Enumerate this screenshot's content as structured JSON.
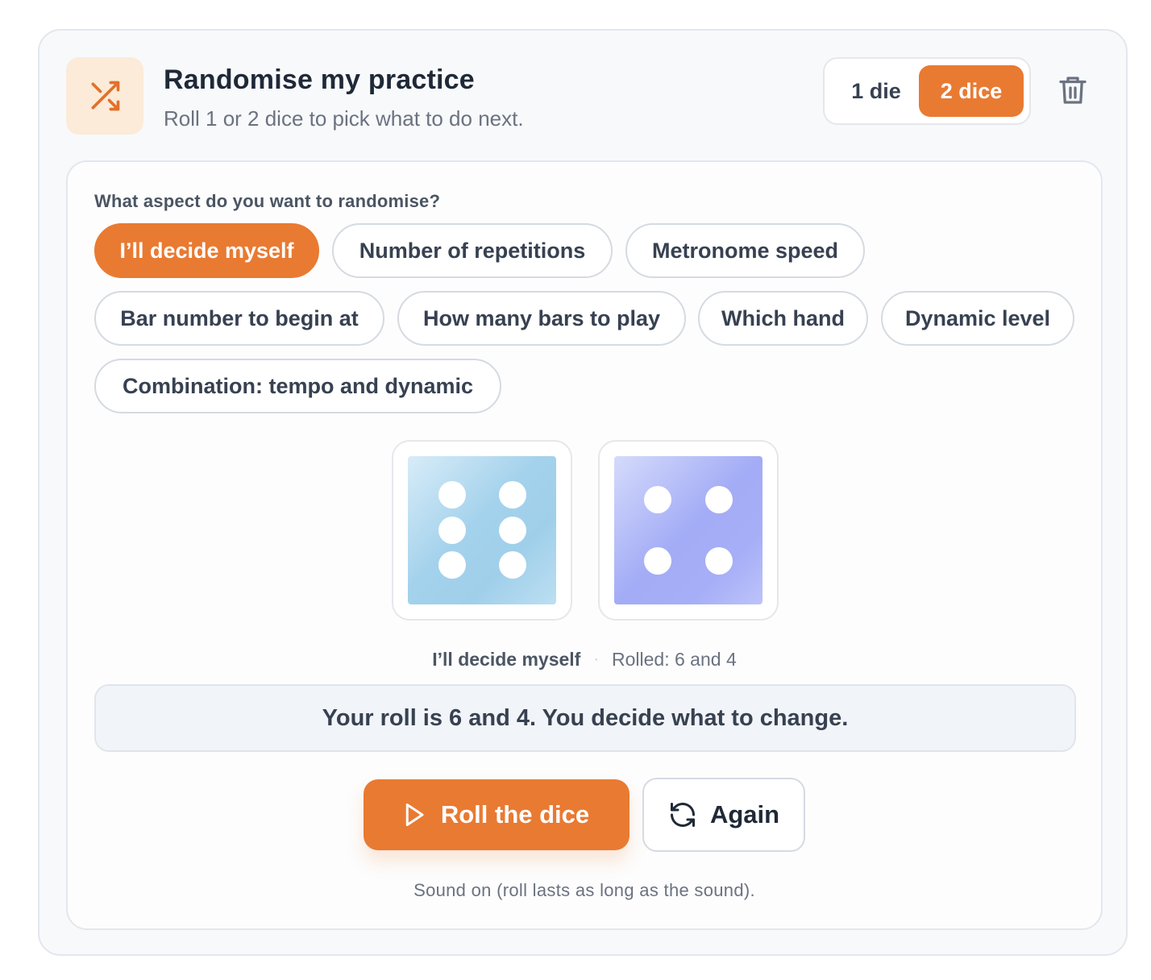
{
  "header": {
    "title": "Randomise my practice",
    "subtitle": "Roll 1 or 2 dice to pick what to do next.",
    "icon": "shuffle-icon",
    "accent_color": "#e97a32"
  },
  "dice_count_toggle": {
    "options": [
      "1 die",
      "2 dice"
    ],
    "selected": "2 dice"
  },
  "delete_icon": "trash-icon",
  "aspect_selector": {
    "question": "What aspect do you want to randomise?",
    "options": [
      "I’ll decide myself",
      "Number of repetitions",
      "Metronome speed",
      "Bar number to begin at",
      "How many bars to play",
      "Which hand",
      "Dynamic level",
      "Combination: tempo and dynamic"
    ],
    "selected": "I’ll decide myself"
  },
  "dice": {
    "values": [
      6,
      4
    ]
  },
  "result": {
    "aspect": "I’ll decide myself",
    "separator": "·",
    "rolled_text": "Rolled: 6 and 4",
    "message": "Your roll is 6 and 4. You decide what to change."
  },
  "actions": {
    "roll_label": "Roll the dice",
    "roll_icon": "play-icon",
    "again_label": "Again",
    "again_icon": "refresh-icon"
  },
  "sound_note": "Sound on (roll lasts as long as the sound)."
}
